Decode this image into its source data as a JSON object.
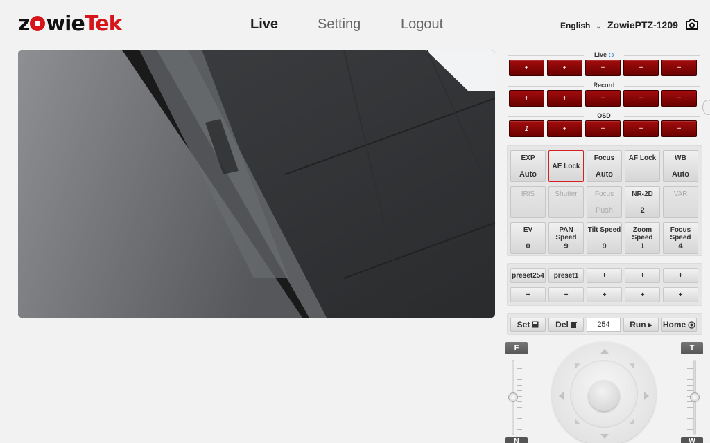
{
  "brand": {
    "logo_text_1": "z",
    "logo_text_2": "wie",
    "logo_text_3": "Tek"
  },
  "nav": {
    "live": "Live",
    "setting": "Setting",
    "logout": "Logout"
  },
  "header": {
    "language": "English",
    "device_name": "ZowiePTZ-1209"
  },
  "colors": {
    "accent_red": "#a30d0d",
    "selected_border": "#d21f1f",
    "brand_red": "#d7141a"
  },
  "live_section": {
    "title": "Live",
    "buttons": [
      "+",
      "+",
      "+",
      "+",
      "+"
    ]
  },
  "record_section": {
    "title": "Record",
    "buttons": [
      "+",
      "+",
      "+",
      "+",
      "+"
    ]
  },
  "osd_section": {
    "title": "OSD",
    "buttons": [
      "1",
      "+",
      "+",
      "+",
      "+"
    ]
  },
  "controls": [
    {
      "label": "EXP",
      "value": "Auto",
      "state": "normal"
    },
    {
      "label": "AE Lock",
      "value": "",
      "state": "selected"
    },
    {
      "label": "Focus",
      "value": "Auto",
      "state": "normal"
    },
    {
      "label": "AF Lock",
      "value": "",
      "state": "normal"
    },
    {
      "label": "WB",
      "value": "Auto",
      "state": "normal"
    },
    {
      "label": "IRIS",
      "value": "",
      "state": "disabled"
    },
    {
      "label": "Shutter",
      "value": "",
      "state": "disabled"
    },
    {
      "label": "Focus",
      "value": "Push",
      "state": "disabled"
    },
    {
      "label": "NR-2D",
      "value": "2",
      "state": "normal"
    },
    {
      "label": "VAR",
      "value": "",
      "state": "disabled"
    },
    {
      "label": "EV",
      "value": "0",
      "state": "normal"
    },
    {
      "label": "PAN Speed",
      "value": "9",
      "state": "normal"
    },
    {
      "label": "Tilt Speed",
      "value": "9",
      "state": "normal"
    },
    {
      "label": "Zoom Speed",
      "value": "1",
      "state": "normal"
    },
    {
      "label": "Focus Speed",
      "value": "4",
      "state": "normal"
    }
  ],
  "presets": [
    "preset254",
    "preset1",
    "+",
    "+",
    "+",
    "+",
    "+",
    "+",
    "+",
    "+"
  ],
  "actions": {
    "set": "Set",
    "del": "Del",
    "preset_number": "254",
    "run": "Run",
    "home": "Home"
  },
  "ptz": {
    "focus_far": "F",
    "focus_near": "N",
    "zoom_tele": "T",
    "zoom_wide": "W",
    "focus_slider_level": 0.5,
    "zoom_slider_level": 0.5
  }
}
